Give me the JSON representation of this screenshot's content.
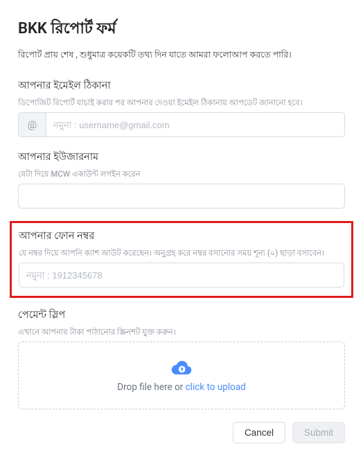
{
  "title": "BKK রিপোর্ট ফর্ম",
  "subtitle": "রিপোর্ট প্রায় শেষ , শুধুমাত্র কয়েকটি তথ্য দিন যাতে আমরা ফলোআপ করতে পারি।",
  "email": {
    "label": "আপনার ইমেইল ঠিকানা",
    "help": "ডিপোজিট রিপোর্ট যাচাই করার পর আপনার দেওয়া ইমেইল ঠিকানায় আপডেট জানানো হবে।",
    "prefix": "@",
    "placeholder": "নমুনা : username@gmail.com"
  },
  "username": {
    "label": "আপনার ইউজারনাম",
    "help": "যেটা দিয়ে MCW একাউন্ট লগইন করেন"
  },
  "phone": {
    "label": "আপনার ফোন নম্বর",
    "help": "যে নম্বর দিয়ে আপনি ক্যাশ আউট করেছেন। অনুগ্রহ করে নম্বর বসানোর সময় শূন্য (০) ছাড়া বসাবেন।",
    "placeholder": "নমুনা : 1912345678"
  },
  "slip": {
    "label": "পেমেন্ট স্লিপ",
    "help": "এখানে আপনার টাকা পাঠানোর স্ক্রিনশট যুক্ত করুন।",
    "drop_text": "Drop file here or ",
    "drop_link": "click to upload"
  },
  "actions": {
    "cancel": "Cancel",
    "submit": "Submit"
  }
}
